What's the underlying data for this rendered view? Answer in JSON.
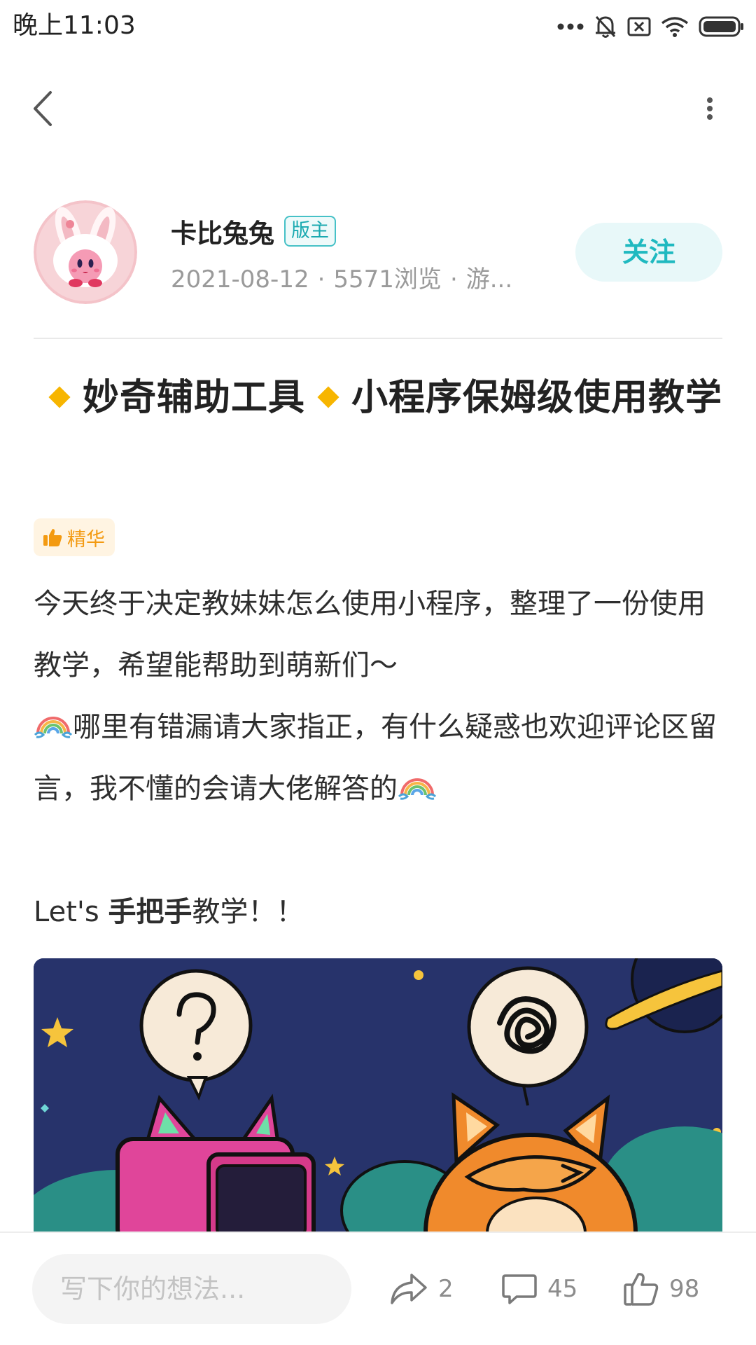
{
  "status_bar": {
    "time": "晚上11:03",
    "icons": [
      "more-dots-icon",
      "bell-off-icon",
      "sim-off-icon",
      "wifi-icon",
      "battery-icon"
    ]
  },
  "top_bar": {
    "back_icon": "chevron-left-icon",
    "more_icon": "vertical-dots-icon"
  },
  "author": {
    "name": "卡比兔兔",
    "role_badge": "版主",
    "date": "2021-08-12",
    "views": "5571浏览",
    "extra": "游...",
    "follow_label": "关注"
  },
  "post": {
    "title_part1": "妙奇辅助工具",
    "title_part2": "小程序保姆级使用教学",
    "diamond_color": "#f7b500",
    "essence_label": "精华",
    "body": {
      "line1": "今天终于决定教妹妹怎么使用小程序，整理了一份使用教学，希望能帮助到萌新们～",
      "line2": "哪里有错漏请大家指正，有什么疑惑也欢迎评论区留言，我不懂的会请大佬解答的",
      "line2_tail": "",
      "line3_prefix": "Let's ",
      "line3_bold": "手把手",
      "line3_rest": "教学！！"
    }
  },
  "bottom_bar": {
    "comment_placeholder": "写下你的想法...",
    "share_count": "2",
    "comment_count": "45",
    "like_count": "98"
  },
  "colors": {
    "accent": "#1fb9c0",
    "accent_bg": "#e8f8f9",
    "essence": "#f39a11",
    "essence_bg": "#fff4e2",
    "illustration_bg": "#27336b"
  }
}
